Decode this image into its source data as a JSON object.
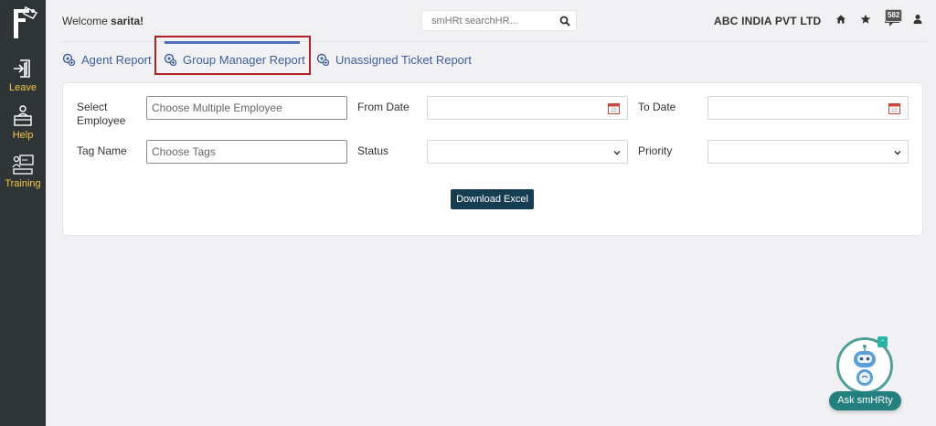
{
  "header": {
    "welcome_prefix": "Welcome ",
    "welcome_user": "sarita!",
    "search_placeholder": "smHRt searchHR...",
    "company": "ABC INDIA PVT LTD",
    "notification_count": "582"
  },
  "sidebar": {
    "items": [
      {
        "label": "Leave",
        "icon": "leave-icon"
      },
      {
        "label": "Help",
        "icon": "help-icon"
      },
      {
        "label": "Training",
        "icon": "training-icon"
      }
    ]
  },
  "tabs": [
    {
      "label": "Agent Report",
      "active": false
    },
    {
      "label": "Group Manager Report",
      "active": true
    },
    {
      "label": "Unassigned Ticket Report",
      "active": false
    }
  ],
  "form": {
    "select_employee_label": "Select Employee",
    "employee_placeholder": "Choose Multiple Employee",
    "from_date_label": "From Date",
    "to_date_label": "To Date",
    "tag_name_label": "Tag Name",
    "tags_placeholder": "Choose Tags",
    "status_label": "Status",
    "priority_label": "Priority",
    "download_button": "Download Excel"
  },
  "chatbot": {
    "button_label": "Ask smHRty",
    "minimize_label": "-"
  },
  "colors": {
    "sidebar_bg": "#2f3437",
    "sidebar_text": "#f5c842",
    "tab_text": "#3e5f9e",
    "active_tab_bar": "#4e6fb8",
    "highlight_border": "#b3202a",
    "button_bg": "#163d52",
    "chatbot_accent": "#23807e"
  }
}
